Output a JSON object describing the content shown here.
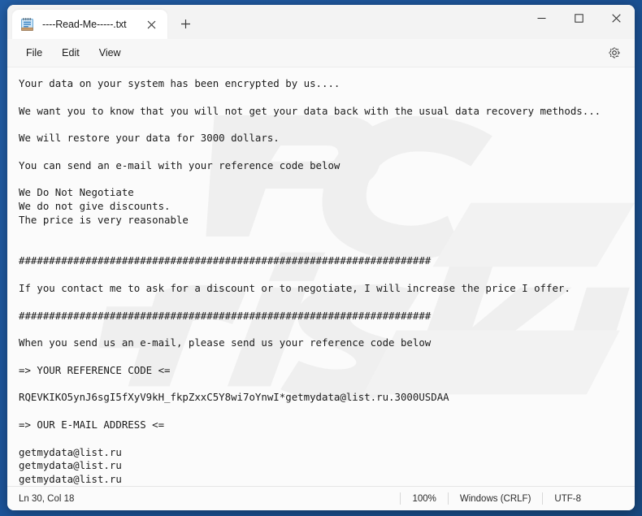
{
  "window": {
    "app": "Notepad",
    "controls": {
      "minimize": "minimize-button",
      "maximize": "maximize-button",
      "close": "close-button"
    }
  },
  "tab": {
    "icon": "notepad-icon",
    "title": "----Read-Me-----.txt",
    "close_label": "✕",
    "new_tab_label": "+"
  },
  "menu": {
    "items": [
      {
        "label": "File"
      },
      {
        "label": "Edit"
      },
      {
        "label": "View"
      }
    ],
    "settings_icon": "gear-icon"
  },
  "document": {
    "lines": [
      "Your data on your system has been encrypted by us....",
      "",
      "We want you to know that you will not get your data back with the usual data recovery methods...",
      "",
      "We will restore your data for 3000 dollars.",
      "",
      "You can send an e-mail with your reference code below",
      "",
      "We Do Not Negotiate",
      "We do not give discounts.",
      "The price is very reasonable",
      "",
      "",
      "####################################################################",
      "",
      "If you contact me to ask for a discount or to negotiate, I will increase the price I offer.",
      "",
      "####################################################################",
      "",
      "When you send us an e-mail, please send us your reference code below",
      "",
      "=> YOUR REFERENCE CODE <=",
      "",
      "RQEVKIKO5ynJ6sgI5fXyV9kH_fkpZxxC5Y8wi7oYnwI*getmydata@list.ru.3000USDAA",
      "",
      "=> OUR E-MAIL ADDRESS <=",
      "",
      "getmydata@list.ru",
      "getmydata@list.ru",
      "getmydata@list.ru"
    ]
  },
  "statusbar": {
    "cursor": "Ln 30, Col 18",
    "zoom": "100%",
    "line_ending": "Windows (CRLF)",
    "encoding": "UTF-8"
  },
  "colors": {
    "desktop": "#1c5499",
    "window_bg": "#f7f7f7",
    "editor_bg": "#fbfbfb",
    "text": "#1b1b1b",
    "watermark": "#efefef"
  }
}
